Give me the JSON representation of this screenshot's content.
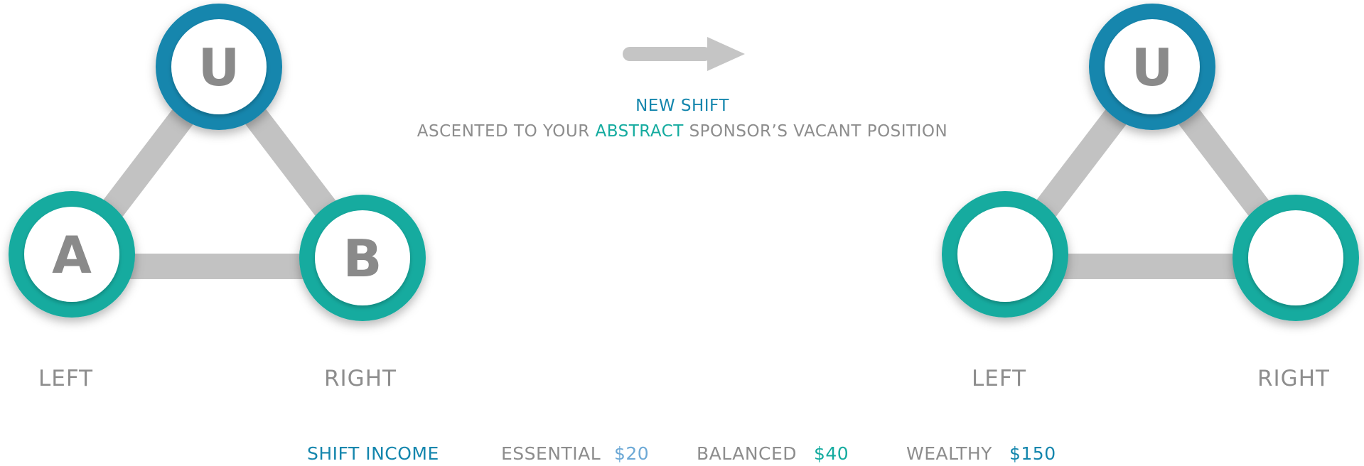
{
  "caption": {
    "title": "NEW SHIFT",
    "line_before": "ASCENTED TO YOUR",
    "line_highlight": "ABSTRACT",
    "line_after": "SPONSOR’S VACANT POSITION"
  },
  "left_tree": {
    "top_node": "U",
    "left_node": "A",
    "right_node": "B",
    "left_label": "LEFT",
    "right_label": "RIGHT"
  },
  "right_tree": {
    "top_node": "U",
    "left_node": "",
    "right_node": "",
    "left_label": "LEFT",
    "right_label": "RIGHT"
  },
  "income": {
    "title": "SHIFT INCOME",
    "tiers": [
      {
        "label": "ESSENTIAL",
        "amount": "$20",
        "color": "#6da9d6"
      },
      {
        "label": "BALANCED",
        "amount": "$40",
        "color": "#14ab9f"
      },
      {
        "label": "WEALTHY",
        "amount": "$150",
        "color": "#1486ad"
      }
    ]
  },
  "colors": {
    "top_ring": "#1486ad",
    "side_ring": "#14ab9f",
    "connector": "#c2c2c2",
    "text_gray": "#8d8d8d"
  }
}
